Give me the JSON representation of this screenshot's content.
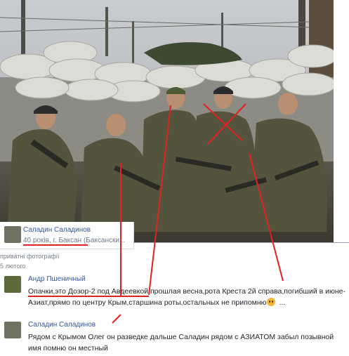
{
  "photo": {
    "alt_icon": "group-photo"
  },
  "profile": {
    "name": "Саладин Саладинов",
    "location": "40 років, г. Баксан (Баксански..."
  },
  "album": {
    "label": "приватні фотографії",
    "date": "5 лютого"
  },
  "comments": [
    {
      "author": "Андр Пшеничный",
      "underlined": "Опачки,это Дозор-2 под Авдеевкой",
      "text": ",прошлая весна,рота Креста 2й справа,погибший в июне-Азиат,прямо по центру Крым,старшина роты,остальных не припомню",
      "ellipsis": " ..."
    },
    {
      "author": "Саладин Саладинов",
      "text": "Рядом с Крымом Олег он разведке дальше Саладин рядом с АЗИАТОМ забыл позывной имя помню он  местный"
    }
  ],
  "colors": {
    "annotation": "#e0231f",
    "link": "#365899"
  }
}
